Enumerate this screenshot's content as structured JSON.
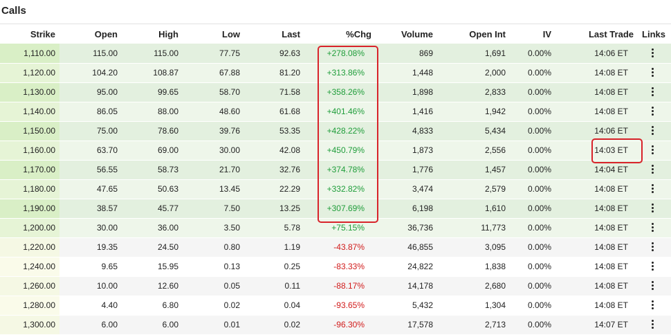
{
  "panel": {
    "title": "Calls"
  },
  "columns": [
    "Strike",
    "Open",
    "High",
    "Low",
    "Last",
    "%Chg",
    "Volume",
    "Open Int",
    "IV",
    "Last Trade",
    "Links"
  ],
  "rows": [
    {
      "strike": "1,110.00",
      "open": "115.00",
      "high": "115.00",
      "low": "77.75",
      "last": "92.63",
      "chg": "+278.08%",
      "dir": "pos",
      "volume": "869",
      "open_int": "1,691",
      "iv": "0.00%",
      "trade": "14:06 ET",
      "itm": true
    },
    {
      "strike": "1,120.00",
      "open": "104.20",
      "high": "108.87",
      "low": "67.88",
      "last": "81.20",
      "chg": "+313.86%",
      "dir": "pos",
      "volume": "1,448",
      "open_int": "2,000",
      "iv": "0.00%",
      "trade": "14:08 ET",
      "itm": true
    },
    {
      "strike": "1,130.00",
      "open": "95.00",
      "high": "99.65",
      "low": "58.70",
      "last": "71.58",
      "chg": "+358.26%",
      "dir": "pos",
      "volume": "1,898",
      "open_int": "2,833",
      "iv": "0.00%",
      "trade": "14:08 ET",
      "itm": true
    },
    {
      "strike": "1,140.00",
      "open": "86.05",
      "high": "88.00",
      "low": "48.60",
      "last": "61.68",
      "chg": "+401.46%",
      "dir": "pos",
      "volume": "1,416",
      "open_int": "1,942",
      "iv": "0.00%",
      "trade": "14:08 ET",
      "itm": true
    },
    {
      "strike": "1,150.00",
      "open": "75.00",
      "high": "78.60",
      "low": "39.76",
      "last": "53.35",
      "chg": "+428.22%",
      "dir": "pos",
      "volume": "4,833",
      "open_int": "5,434",
      "iv": "0.00%",
      "trade": "14:06 ET",
      "itm": true
    },
    {
      "strike": "1,160.00",
      "open": "63.70",
      "high": "69.00",
      "low": "30.00",
      "last": "42.08",
      "chg": "+450.79%",
      "dir": "pos",
      "volume": "1,873",
      "open_int": "2,556",
      "iv": "0.00%",
      "trade": "14:03 ET",
      "itm": true
    },
    {
      "strike": "1,170.00",
      "open": "56.55",
      "high": "58.73",
      "low": "21.70",
      "last": "32.76",
      "chg": "+374.78%",
      "dir": "pos",
      "volume": "1,776",
      "open_int": "1,457",
      "iv": "0.00%",
      "trade": "14:04 ET",
      "itm": true
    },
    {
      "strike": "1,180.00",
      "open": "47.65",
      "high": "50.63",
      "low": "13.45",
      "last": "22.29",
      "chg": "+332.82%",
      "dir": "pos",
      "volume": "3,474",
      "open_int": "2,579",
      "iv": "0.00%",
      "trade": "14:08 ET",
      "itm": true
    },
    {
      "strike": "1,190.00",
      "open": "38.57",
      "high": "45.77",
      "low": "7.50",
      "last": "13.25",
      "chg": "+307.69%",
      "dir": "pos",
      "volume": "6,198",
      "open_int": "1,610",
      "iv": "0.00%",
      "trade": "14:08 ET",
      "itm": true
    },
    {
      "strike": "1,200.00",
      "open": "30.00",
      "high": "36.00",
      "low": "3.50",
      "last": "5.78",
      "chg": "+75.15%",
      "dir": "pos",
      "volume": "36,736",
      "open_int": "11,773",
      "iv": "0.00%",
      "trade": "14:08 ET",
      "itm": true
    },
    {
      "strike": "1,220.00",
      "open": "19.35",
      "high": "24.50",
      "low": "0.80",
      "last": "1.19",
      "chg": "-43.87%",
      "dir": "neg",
      "volume": "46,855",
      "open_int": "3,095",
      "iv": "0.00%",
      "trade": "14:08 ET",
      "itm": false
    },
    {
      "strike": "1,240.00",
      "open": "9.65",
      "high": "15.95",
      "low": "0.13",
      "last": "0.25",
      "chg": "-83.33%",
      "dir": "neg",
      "volume": "24,822",
      "open_int": "1,838",
      "iv": "0.00%",
      "trade": "14:08 ET",
      "itm": false
    },
    {
      "strike": "1,260.00",
      "open": "10.00",
      "high": "12.60",
      "low": "0.05",
      "last": "0.11",
      "chg": "-88.17%",
      "dir": "neg",
      "volume": "14,178",
      "open_int": "2,680",
      "iv": "0.00%",
      "trade": "14:08 ET",
      "itm": false
    },
    {
      "strike": "1,280.00",
      "open": "4.40",
      "high": "6.80",
      "low": "0.02",
      "last": "0.04",
      "chg": "-93.65%",
      "dir": "neg",
      "volume": "5,432",
      "open_int": "1,304",
      "iv": "0.00%",
      "trade": "14:08 ET",
      "itm": false
    },
    {
      "strike": "1,300.00",
      "open": "6.00",
      "high": "6.00",
      "low": "0.01",
      "last": "0.02",
      "chg": "-96.30%",
      "dir": "neg",
      "volume": "17,578",
      "open_int": "2,713",
      "iv": "0.00%",
      "trade": "14:07 ET",
      "itm": false
    }
  ],
  "links_icon": "kebab-menu-icon",
  "colors": {
    "positive": "#1f9d3a",
    "negative": "#d11a1a",
    "highlight": "#d8232a",
    "in_the_money": "#e3f0df"
  }
}
